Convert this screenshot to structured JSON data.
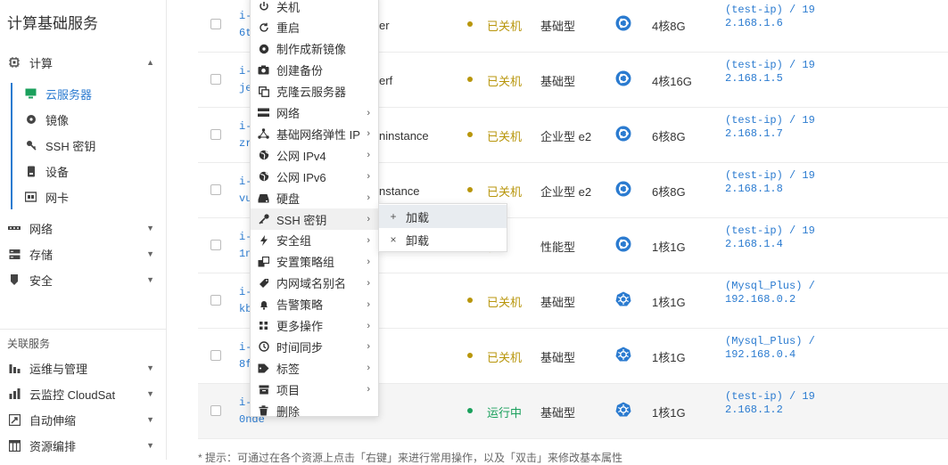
{
  "sidebar": {
    "title": "计算基础服务",
    "compute": {
      "label": "计算",
      "icon": "chip-icon"
    },
    "sub_items": [
      {
        "label": "云服务器",
        "icon": "monitor-icon",
        "active": true
      },
      {
        "label": "镜像",
        "icon": "disc-icon"
      },
      {
        "label": "SSH 密钥",
        "icon": "key-icon"
      },
      {
        "label": "设备",
        "icon": "device-icon"
      },
      {
        "label": "网卡",
        "icon": "nic-icon"
      }
    ],
    "groups": [
      {
        "label": "网络",
        "icon": "network-icon"
      },
      {
        "label": "存储",
        "icon": "storage-icon"
      },
      {
        "label": "安全",
        "icon": "shield-icon"
      }
    ],
    "related_label": "关联服务",
    "related": [
      {
        "label": "运维与管理",
        "icon": "ops-icon"
      },
      {
        "label": "云监控 CloudSat",
        "icon": "chart-icon"
      },
      {
        "label": "自动伸缩",
        "icon": "scale-icon"
      },
      {
        "label": "资源编排",
        "icon": "table-icon"
      }
    ]
  },
  "table": {
    "rows": [
      {
        "id_l1": "i-",
        "id_l2": "6t",
        "name": "er",
        "status": "已关机",
        "status_color": "#b8960c",
        "type": "基础型",
        "os": "ubuntu-icon",
        "spec": "4核8G",
        "ip": "(test-ip) / 19\n2.168.1.6"
      },
      {
        "id_l1": "i-",
        "id_l2": "je",
        "name": "erf",
        "status": "已关机",
        "status_color": "#b8960c",
        "type": "基础型",
        "os": "ubuntu-icon",
        "spec": "4核16G",
        "ip": "(test-ip) / 19\n2.168.1.5"
      },
      {
        "id_l1": "i-",
        "id_l2": "zr",
        "name": "ninstance",
        "status": "已关机",
        "status_color": "#b8960c",
        "type": "企业型 e2",
        "os": "ubuntu-icon",
        "spec": "6核8G",
        "ip": "(test-ip) / 19\n2.168.1.7"
      },
      {
        "id_l1": "i-",
        "id_l2": "vu",
        "name": "nstance",
        "status": "已关机",
        "status_color": "#b8960c",
        "type": "企业型 e2",
        "os": "ubuntu-icon",
        "spec": "6核8G",
        "ip": "(test-ip) / 19\n2.168.1.8"
      },
      {
        "id_l1": "i-",
        "id_l2": "1n",
        "name": "",
        "status": "机",
        "status_color": "#b8960c",
        "type": "性能型",
        "os": "ubuntu-icon",
        "spec": "1核1G",
        "ip": "(test-ip) / 19\n2.168.1.4"
      },
      {
        "id_l1": "i-",
        "id_l2": "kb",
        "name": "",
        "status": "已关机",
        "status_color": "#b8960c",
        "type": "基础型",
        "os": "kubernetes-icon",
        "spec": "1核1G",
        "ip": "(Mysql_Plus) /\n192.168.0.2"
      },
      {
        "id_l1": "i-",
        "id_l2": "8f",
        "name": "",
        "status": "已关机",
        "status_color": "#b8960c",
        "type": "基础型",
        "os": "kubernetes-icon",
        "spec": "1核1G",
        "ip": "(Mysql_Plus) /\n192.168.0.4"
      },
      {
        "id_l1": "i-",
        "id_l2": "0nde",
        "name": "",
        "status": "运行中",
        "status_color": "#1aa05c",
        "type": "基础型",
        "os": "kubernetes-icon",
        "spec": "1核1G",
        "ip": "(test-ip) / 19\n2.168.1.2"
      }
    ]
  },
  "hint": "* 提示：可通过在各个资源上点击「右键」来进行常用操作，以及「双击」来修改基本属性",
  "context_menu": {
    "items": [
      {
        "label": "关机",
        "icon": "power-icon",
        "submenu": false
      },
      {
        "label": "重启",
        "icon": "restart-icon",
        "submenu": false
      },
      {
        "label": "制作成新镜像",
        "icon": "image-icon",
        "submenu": false
      },
      {
        "label": "创建备份",
        "icon": "camera-icon",
        "submenu": false
      },
      {
        "label": "克隆云服务器",
        "icon": "clone-icon",
        "submenu": false
      },
      {
        "label": "网络",
        "icon": "network-icon",
        "submenu": true
      },
      {
        "label": "基础网络弹性 IP",
        "icon": "eip-icon",
        "submenu": true
      },
      {
        "label": "公网 IPv4",
        "icon": "globe-icon",
        "submenu": true
      },
      {
        "label": "公网 IPv6",
        "icon": "globe-icon",
        "submenu": true
      },
      {
        "label": "硬盘",
        "icon": "disk-icon",
        "submenu": true
      },
      {
        "label": "SSH 密钥",
        "icon": "key-icon",
        "submenu": true,
        "highlighted": true
      },
      {
        "label": "安全组",
        "icon": "bolt-icon",
        "submenu": true
      },
      {
        "label": "安置策略组",
        "icon": "placement-icon",
        "submenu": true
      },
      {
        "label": "内网域名别名",
        "icon": "tag-icon",
        "submenu": true
      },
      {
        "label": "告警策略",
        "icon": "bell-icon",
        "submenu": true
      },
      {
        "label": "更多操作",
        "icon": "grid-icon",
        "submenu": true
      },
      {
        "label": "时间同步",
        "icon": "clock-icon",
        "submenu": true
      },
      {
        "label": "标签",
        "icon": "label-icon",
        "submenu": true
      },
      {
        "label": "项目",
        "icon": "project-icon",
        "submenu": true
      },
      {
        "label": "删除",
        "icon": "trash-icon",
        "submenu": false
      }
    ]
  },
  "ssh_submenu": {
    "items": [
      {
        "label": "加载",
        "glyph": "+",
        "highlighted": true
      },
      {
        "label": "卸载",
        "glyph": "×"
      }
    ]
  }
}
